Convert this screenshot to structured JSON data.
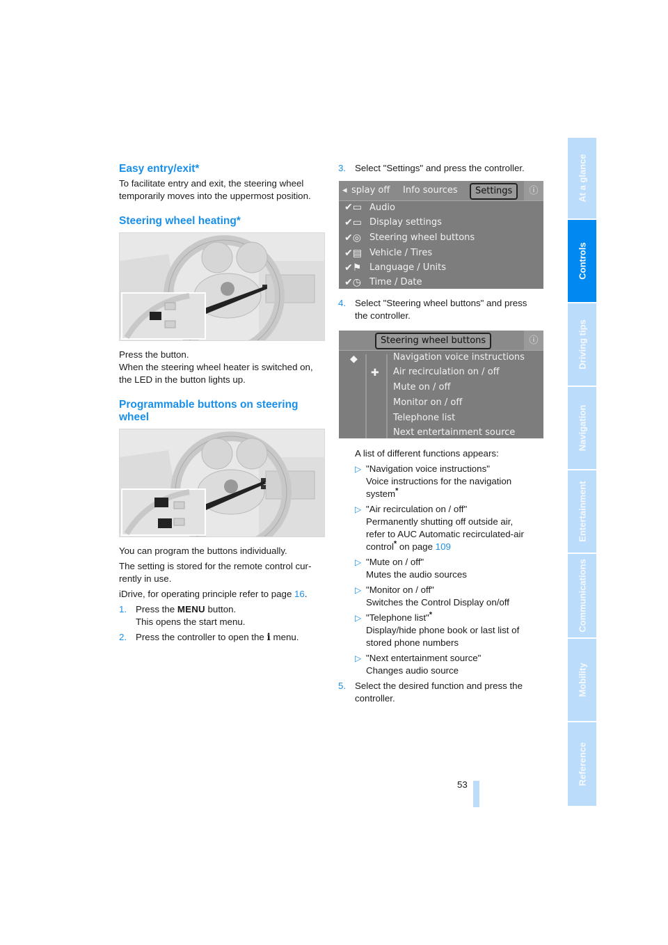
{
  "left_column": {
    "easy_entry": {
      "heading": "Easy entry/exit*",
      "body_line1": "To facilitate entry and exit, the steering wheel",
      "body_line2": "temporarily moves into the uppermost position."
    },
    "heating": {
      "heading": "Steering wheel heating*",
      "figure": "steering-wheel-heating-button-illustration",
      "line1": "Press the button.",
      "line2": "When the steering wheel heater is switched on,",
      "line3": "the LED in the button lights up."
    },
    "programmable": {
      "heading_line1": "Programmable buttons on steering",
      "heading_line2": "wheel",
      "figure": "programmable-steering-wheel-buttons-illustration",
      "p1": "You can program the buttons individually.",
      "p2_line1": "The setting is stored for the remote control cur-",
      "p2_line2": "rently in use.",
      "p3_text": "iDrive, for operating principle refer to page ",
      "p3_link": "16",
      "p3_end": ".",
      "steps": [
        {
          "num": "1.",
          "pre": "Press the ",
          "key": "MENU",
          "post": " button.",
          "line2": "This opens the start menu."
        },
        {
          "num": "2.",
          "pre": "Press the controller to open the ",
          "key": "i",
          "post": " menu."
        }
      ]
    }
  },
  "right_column": {
    "step3": {
      "num": "3.",
      "text": "Select \"Settings\" and press the controller."
    },
    "settings_screen": {
      "top_left_arrow": "◂",
      "tabs": [
        "splay off",
        "Info sources",
        "Settings"
      ],
      "selected_tab": "Settings",
      "items": [
        {
          "icon": "audio-icon",
          "label": "Audio"
        },
        {
          "icon": "display-icon",
          "label": "Display settings"
        },
        {
          "icon": "steering-wheel-icon",
          "label": "Steering wheel buttons"
        },
        {
          "icon": "vehicle-icon",
          "label": "Vehicle / Tires"
        },
        {
          "icon": "flag-icon",
          "label": "Language / Units"
        },
        {
          "icon": "clock-icon",
          "label": "Time / Date"
        }
      ]
    },
    "step4": {
      "num": "4.",
      "line1": "Select \"Steering wheel buttons\" and press",
      "line2": "the controller."
    },
    "buttons_screen": {
      "title": "Steering wheel buttons",
      "items": [
        "Navigation voice instructions",
        "Air recirculation on / off",
        "Mute on / off",
        "Monitor on / off",
        "Telephone list",
        "Next entertainment source"
      ],
      "left_symbols": [
        "◆",
        "✚"
      ]
    },
    "list_intro": "A list of different functions appears:",
    "bullets": [
      {
        "title": "\"Navigation voice instructions\"",
        "desc": [
          "Voice instructions for the navigation",
          "system"
        ],
        "desc_star": true
      },
      {
        "title": "\"Air recirculation on / off\"",
        "desc": [
          "Permanently shutting off outside air,",
          "refer to AUC Automatic recirculated-air",
          "control"
        ],
        "desc_tail": " on page ",
        "link": "109"
      },
      {
        "title": "\"Mute on / off\"",
        "desc": [
          "Mutes the audio sources"
        ]
      },
      {
        "title": "\"Monitor on / off\"",
        "desc": [
          "Switches the Control Display on/off"
        ]
      },
      {
        "title": "\"Telephone list\"",
        "title_star": true,
        "desc": [
          "Display/hide phone book or last list of",
          "stored phone numbers"
        ]
      },
      {
        "title": "\"Next entertainment source\"",
        "desc": [
          "Changes audio source"
        ]
      }
    ],
    "step5": {
      "num": "5.",
      "line1": "Select the desired function and press the",
      "line2": "controller."
    }
  },
  "sidebar_tabs": [
    {
      "label": "At a glance",
      "active": false
    },
    {
      "label": "Controls",
      "active": true
    },
    {
      "label": "Driving tips",
      "active": false
    },
    {
      "label": "Navigation",
      "active": false
    },
    {
      "label": "Entertainment",
      "active": false
    },
    {
      "label": "Communications",
      "active": false
    },
    {
      "label": "Mobility",
      "active": false
    },
    {
      "label": "Reference",
      "active": false
    }
  ],
  "page_number": "53",
  "star": "*"
}
